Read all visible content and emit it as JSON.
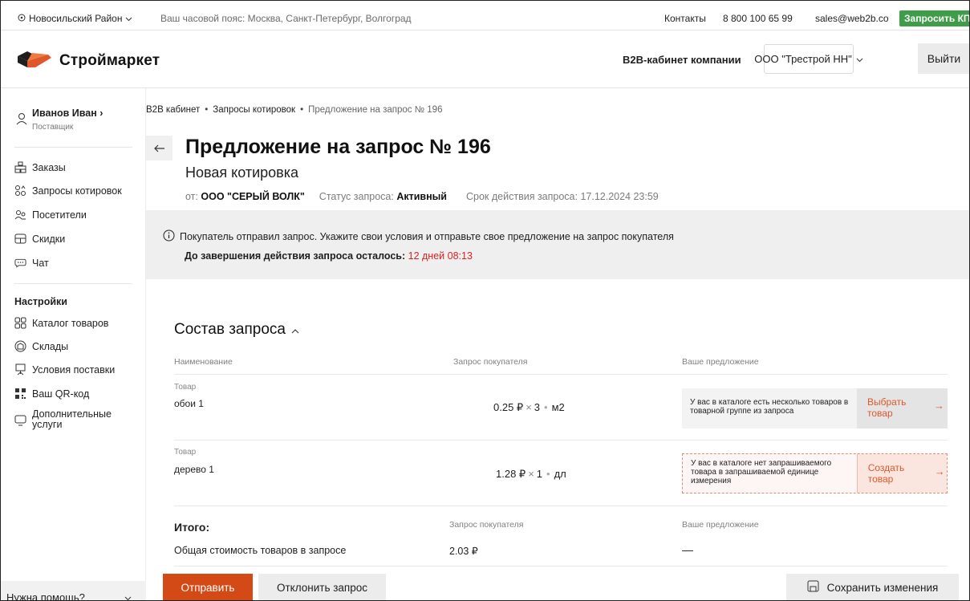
{
  "topbar": {
    "region": "Новосильский Район",
    "timezone": "Ваш часовой пояс: Москва, Санкт-Петербург, Волгоград",
    "contacts": "Контакты",
    "phone": "8 800 100 65 99",
    "email": "sales@web2b.co",
    "request_kp": "Запросить КП"
  },
  "header": {
    "logo_text": "Строймаркет",
    "cabinet_label": "B2B-кабинет компании",
    "company": "ООО \"Трестрой НН\"",
    "logout": "Выйти"
  },
  "sidebar": {
    "user_name": "Иванов Иван ›",
    "user_role": "Поставщик",
    "items": [
      {
        "label": "Заказы",
        "icon": "orders-icon"
      },
      {
        "label": "Запросы котировок",
        "icon": "quotes-icon"
      },
      {
        "label": "Посетители",
        "icon": "visitors-icon"
      },
      {
        "label": "Скидки",
        "icon": "discounts-icon"
      },
      {
        "label": "Чат",
        "icon": "chat-icon"
      }
    ],
    "settings_heading": "Настройки",
    "settings_items": [
      {
        "label": "Каталог товаров",
        "icon": "catalog-icon"
      },
      {
        "label": "Склады",
        "icon": "warehouse-icon"
      },
      {
        "label": "Условия поставки",
        "icon": "delivery-icon"
      },
      {
        "label": "Ваш QR-код",
        "icon": "qr-icon"
      },
      {
        "label": "Дополнительные услуги",
        "icon": "services-icon"
      }
    ],
    "help": "Нужна помощь?"
  },
  "breadcrumb": {
    "items": [
      "B2B кабинет",
      "Запросы котировок"
    ],
    "current": "Предложение на запрос № 196"
  },
  "page": {
    "title": "Предложение на запрос № 196",
    "subtitle": "Новая котировка",
    "from_label": "от:",
    "from_value": "ООО \"СЕРЫЙ ВОЛК\"",
    "status_label": "Статус запроса:",
    "status_value": "Активный",
    "deadline": "Срок действия запроса: 17.12.2024 23:59"
  },
  "notice": {
    "text": "Покупатель отправил запрос. Укажите свои условия и отправьте свое предложение на запрос покупателя",
    "deadline_label": "До завершения действия запроса осталось:",
    "deadline_value": "12 дней 08:13"
  },
  "request": {
    "title": "Состав запроса",
    "columns": [
      "Наименование",
      "Запрос покупателя",
      "Ваше предложение"
    ],
    "rows": [
      {
        "type": "Товар",
        "name": "обои 1",
        "price": "0.25 ₽",
        "qty": "3",
        "unit": "м2",
        "offer_text": "У вас в каталоге есть несколько товаров в товарной группе из запроса",
        "offer_action": "Выбрать товар"
      },
      {
        "type": "Товар",
        "name": "дерево 1",
        "price": "1.28 ₽",
        "qty": "1",
        "unit": "дл",
        "offer_text": "У вас в каталоге нет запрашиваемого товара в запрашиваемой единице измерения",
        "offer_action": "Создать товар"
      }
    ],
    "total_label": "Итого:",
    "total_col_request": "Запрос покупателя",
    "total_col_offer": "Ваше предложение",
    "total_row_label": "Общая стоимость товаров в запросе",
    "total_value": "2.03 ₽",
    "total_offer": "—"
  },
  "footer": {
    "send": "Отправить",
    "reject": "Отклонить запрос",
    "save": "Сохранить изменения"
  },
  "colors": {
    "accent": "#d44a17",
    "offer_action": "#e0572a",
    "deadline": "#e02020",
    "kp_button": "#3f9c48"
  }
}
